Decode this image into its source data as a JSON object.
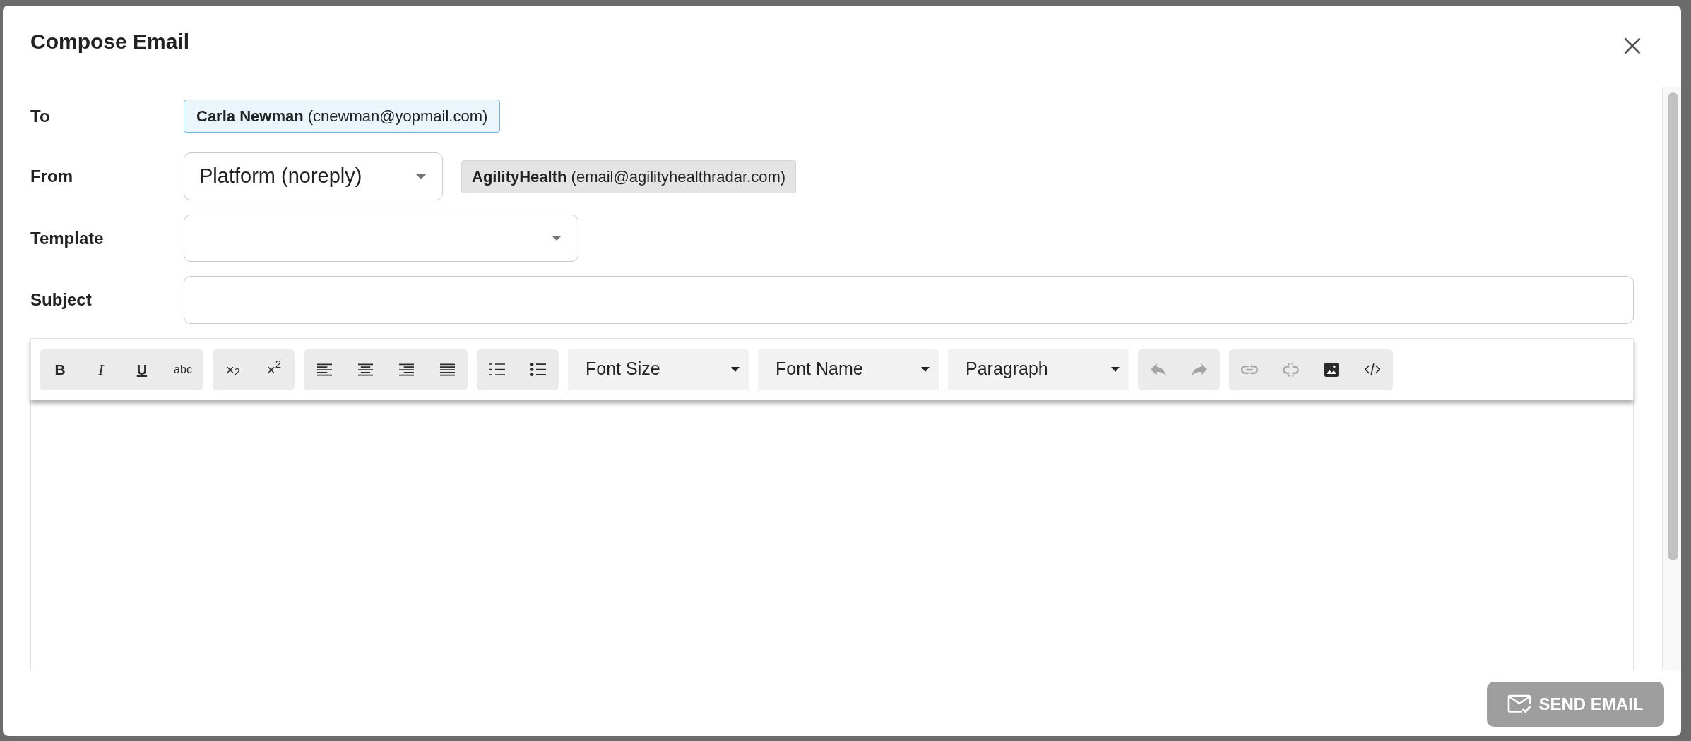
{
  "dialog": {
    "title": "Compose Email"
  },
  "fields": [
    {
      "kind": "recipients",
      "label": "To",
      "chips": [
        "**Carla Newman** (cnewman@yopmail.com)"
      ]
    },
    {
      "kind": "sender",
      "label": "From",
      "value": "Platform (noreply)",
      "chips": [
        "**AgilityHealth** (email@agilityhealthradar.com)"
      ]
    },
    {
      "kind": "select",
      "label": "Template"
    },
    {
      "kind": "text",
      "label": "Subject"
    }
  ],
  "toolbar": [
    {
      "kind": "group",
      "buttons": [
        {
          "kind": "bold",
          "label": "B",
          "disabled": false
        },
        {
          "kind": "italic",
          "label": "I",
          "disabled": false
        },
        {
          "kind": "underline",
          "label": "U",
          "disabled": false
        },
        {
          "kind": "strikethrough",
          "label": "abc",
          "disabled": false
        }
      ]
    },
    {
      "kind": "group",
      "buttons": [
        {
          "kind": "subscript",
          "label": "×$_{2}$",
          "disabled": false
        },
        {
          "kind": "superscript",
          "label": "×$^{2}$",
          "disabled": false
        }
      ]
    },
    {
      "kind": "group",
      "buttons": [
        {
          "kind": "align-left",
          "disabled": false
        },
        {
          "kind": "align-center",
          "disabled": false
        },
        {
          "kind": "align-right",
          "disabled": false
        },
        {
          "kind": "justify",
          "disabled": false
        }
      ]
    },
    {
      "kind": "group",
      "buttons": [
        {
          "kind": "ordered-list",
          "disabled": false
        },
        {
          "kind": "bulleted-list",
          "disabled": false
        }
      ]
    },
    {
      "kind": "dropdown",
      "label": "Font Size"
    },
    {
      "kind": "dropdown",
      "label": "Font Name"
    },
    {
      "kind": "dropdown",
      "label": "Paragraph"
    },
    {
      "kind": "group",
      "buttons": [
        {
          "kind": "undo",
          "disabled": true
        },
        {
          "kind": "redo",
          "disabled": true
        }
      ]
    },
    {
      "kind": "group",
      "buttons": [
        {
          "kind": "link",
          "disabled": true
        },
        {
          "kind": "unlink",
          "disabled": true
        },
        {
          "kind": "image",
          "disabled": false
        },
        {
          "kind": "code",
          "disabled": false
        }
      ]
    }
  ],
  "send_button": {
    "label": "SEND EMAIL",
    "disabled": true
  }
}
